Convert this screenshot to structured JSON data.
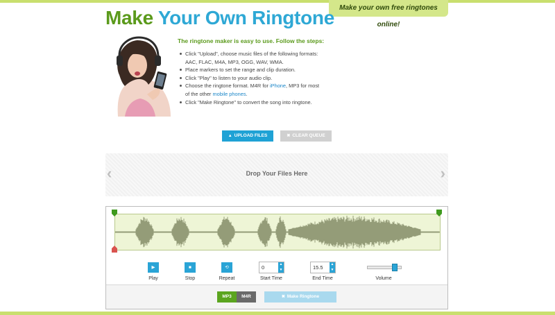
{
  "header": {
    "logo_part1": "Make ",
    "logo_part2": "Your Own Ringtone",
    "tagline": "Make your own free ringtones online!"
  },
  "intro": {
    "heading": "The ringtone maker is easy to use. Follow the steps:",
    "steps": [
      {
        "text": "Click \"Upload\", choose music files of the following formats: AAC, FLAC, M4A, MP3, OGG, WAV, WMA."
      },
      {
        "text": "Place markers to set the range and clip duration."
      },
      {
        "text": "Click \"Play\" to listen to your audio clip."
      },
      {
        "pre": "Choose the ringtone format. M4R for ",
        "link1": "iPhone",
        "mid": ", MP3 for most of the other ",
        "link2": "mobile phones",
        "post": "."
      },
      {
        "text": "Click \"Make Ringtone\" to convert the song into ringtone."
      }
    ]
  },
  "buttons": {
    "upload": "Upload files",
    "clear": "Clear queue"
  },
  "dropzone": {
    "text": "Drop Your Files Here",
    "prev": "‹",
    "next": "›"
  },
  "controls": {
    "play": "Play",
    "stop": "Stop",
    "repeat": "Repeat",
    "start_time_label": "Start Time",
    "start_time_value": "0",
    "end_time_label": "End Time",
    "end_time_value": "15.5",
    "volume_label": "Volume",
    "volume_level": 0.8
  },
  "format": {
    "options": [
      "MP3",
      "M4R"
    ],
    "selected": "MP3",
    "make_label": "Make Ringtone"
  },
  "colors": {
    "accent_blue": "#2aa4d6",
    "accent_green": "#5ba51f",
    "lime": "#c9df6e"
  }
}
